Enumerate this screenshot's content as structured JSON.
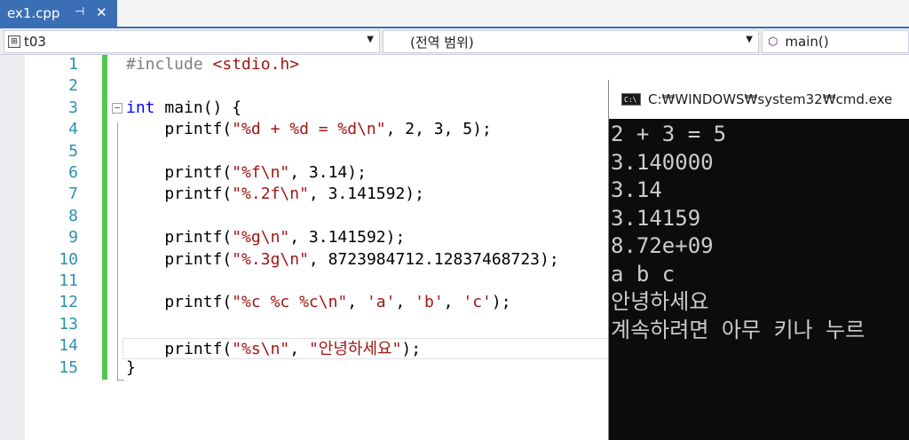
{
  "tab": {
    "title": "ex1.cpp",
    "pin_icon": "pin-icon",
    "close_icon": "close-icon"
  },
  "nav": {
    "project": "t03",
    "scope": "(전역 범위)",
    "member": "main()"
  },
  "editor": {
    "line_numbers": [
      "1",
      "2",
      "3",
      "4",
      "5",
      "6",
      "7",
      "8",
      "9",
      "10",
      "11",
      "12",
      "13",
      "14",
      "15"
    ],
    "fold_toggle": "−",
    "lines": [
      [
        {
          "t": "#include ",
          "c": "pp"
        },
        {
          "t": "<stdio.h>",
          "c": "str"
        }
      ],
      [],
      [
        {
          "t": "int",
          "c": "kw"
        },
        {
          "t": " main() {",
          "c": ""
        }
      ],
      [
        {
          "t": "    printf(",
          "c": ""
        },
        {
          "t": "\"%d + %d = %d\\n\"",
          "c": "str"
        },
        {
          "t": ", 2, 3, 5);",
          "c": ""
        }
      ],
      [],
      [
        {
          "t": "    printf(",
          "c": ""
        },
        {
          "t": "\"%f\\n\"",
          "c": "str"
        },
        {
          "t": ", 3.14);",
          "c": ""
        }
      ],
      [
        {
          "t": "    printf(",
          "c": ""
        },
        {
          "t": "\"%.2f\\n\"",
          "c": "str"
        },
        {
          "t": ", 3.141592);",
          "c": ""
        }
      ],
      [],
      [
        {
          "t": "    printf(",
          "c": ""
        },
        {
          "t": "\"%g\\n\"",
          "c": "str"
        },
        {
          "t": ", 3.141592);",
          "c": ""
        }
      ],
      [
        {
          "t": "    printf(",
          "c": ""
        },
        {
          "t": "\"%.3g\\n\"",
          "c": "str"
        },
        {
          "t": ", 8723984712.12837468723);",
          "c": ""
        }
      ],
      [],
      [
        {
          "t": "    printf(",
          "c": ""
        },
        {
          "t": "\"%c %c %c\\n\"",
          "c": "str"
        },
        {
          "t": ", ",
          "c": ""
        },
        {
          "t": "'a'",
          "c": "str"
        },
        {
          "t": ", ",
          "c": ""
        },
        {
          "t": "'b'",
          "c": "str"
        },
        {
          "t": ", ",
          "c": ""
        },
        {
          "t": "'c'",
          "c": "str"
        },
        {
          "t": ");",
          "c": ""
        }
      ],
      [],
      [
        {
          "t": "    printf(",
          "c": ""
        },
        {
          "t": "\"%s\\n\"",
          "c": "str"
        },
        {
          "t": ", ",
          "c": ""
        },
        {
          "t": "\"안녕하세요\"",
          "c": "str"
        },
        {
          "t": ");",
          "c": ""
        }
      ],
      [
        {
          "t": "}",
          "c": ""
        }
      ]
    ]
  },
  "console": {
    "title": "C:₩WINDOWS₩system32₩cmd.exe",
    "icon_label": "C:\\",
    "output": [
      "2 + 3 = 5",
      "3.140000",
      "3.14",
      "3.14159",
      "8.72e+09",
      "a b c",
      "안녕하세요",
      "계속하려면 아무 키나 누르"
    ]
  },
  "colors": {
    "tab_active": "#3b6fb5",
    "line_number": "#2b91af",
    "keyword": "#0000ff",
    "string": "#a31515",
    "change_bar": "#50c850",
    "console_bg": "#0c0c0c"
  }
}
